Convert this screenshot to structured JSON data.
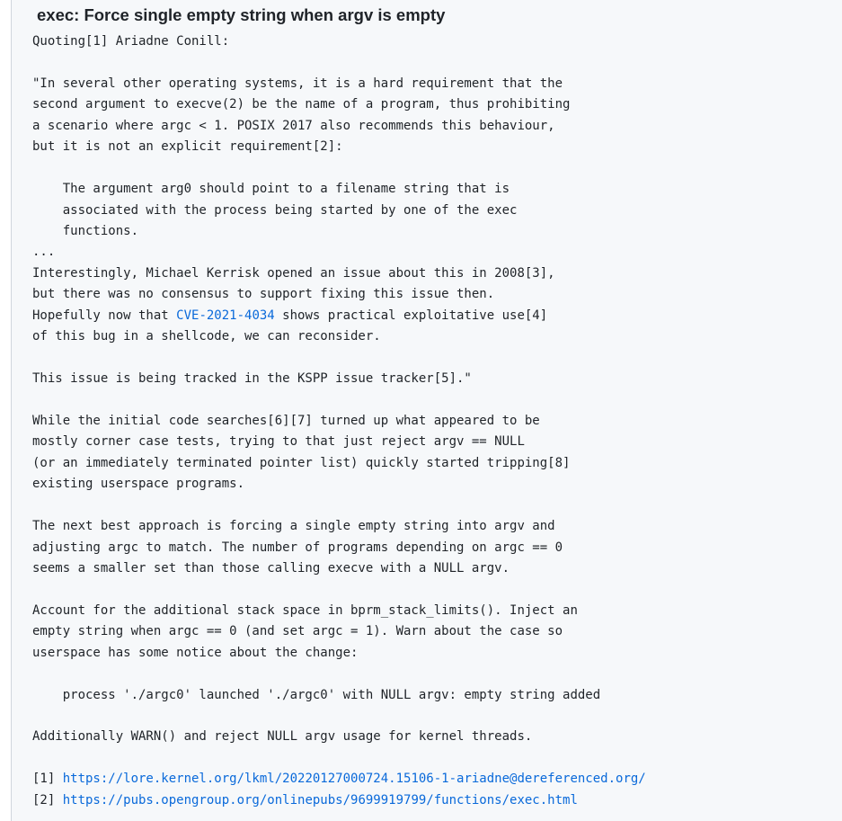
{
  "commit": {
    "title": "exec: Force single empty string when argv is empty",
    "body_lines": [
      "Quoting[1] Ariadne Conill:",
      "",
      "\"In several other operating systems, it is a hard requirement that the",
      "second argument to execve(2) be the name of a program, thus prohibiting",
      "a scenario where argc < 1. POSIX 2017 also recommends this behaviour,",
      "but it is not an explicit requirement[2]:",
      "",
      "    The argument arg0 should point to a filename string that is",
      "    associated with the process being started by one of the exec",
      "    functions.",
      "...",
      "Interestingly, Michael Kerrisk opened an issue about this in 2008[3],",
      "but there was no consensus to support fixing this issue then.",
      "Hopefully now that ",
      "of this bug in a shellcode, we can reconsider.",
      "",
      "This issue is being tracked in the KSPP issue tracker[5].\"",
      "",
      "While the initial code searches[6][7] turned up what appeared to be",
      "mostly corner case tests, trying to that just reject argv == NULL",
      "(or an immediately terminated pointer list) quickly started tripping[8]",
      "existing userspace programs.",
      "",
      "The next best approach is forcing a single empty string into argv and",
      "adjusting argc to match. The number of programs depending on argc == 0",
      "seems a smaller set than those calling execve with a NULL argv.",
      "",
      "Account for the additional stack space in bprm_stack_limits(). Inject an",
      "empty string when argc == 0 (and set argc = 1). Warn about the case so",
      "userspace has some notice about the change:",
      "",
      "    process './argc0' launched './argc0' with NULL argv: empty string added",
      "",
      "Additionally WARN() and reject NULL argv usage for kernel threads.",
      "",
      "[1] ",
      "[2] "
    ],
    "cve_link": "CVE-2021-4034",
    "cve_suffix": " shows practical exploitative use[4]",
    "ref_links": [
      "https://lore.kernel.org/lkml/20220127000724.15106-1-ariadne@dereferenced.org/",
      "https://pubs.opengroup.org/onlinepubs/9699919799/functions/exec.html"
    ]
  },
  "colors": {
    "text": "#1f2328",
    "link": "#0969da",
    "panel_bg": "#f6f8fa",
    "panel_border": "#d0d7de"
  }
}
